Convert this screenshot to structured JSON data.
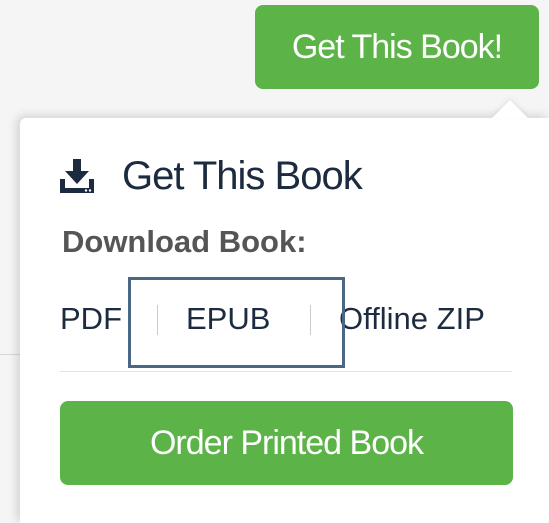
{
  "header": {
    "get_book_button_label": "Get This Book!"
  },
  "popover": {
    "title": "Get This Book",
    "title_icon": "download-icon",
    "download_label": "Download Book:",
    "links": [
      {
        "label": "PDF"
      },
      {
        "label": "EPUB"
      },
      {
        "label": "Offline ZIP"
      }
    ],
    "order_button_label": "Order Printed Book"
  },
  "colors": {
    "accent_green": "#5cb347",
    "title_navy": "#1c2b3f",
    "highlight_box": "#4a6786"
  }
}
